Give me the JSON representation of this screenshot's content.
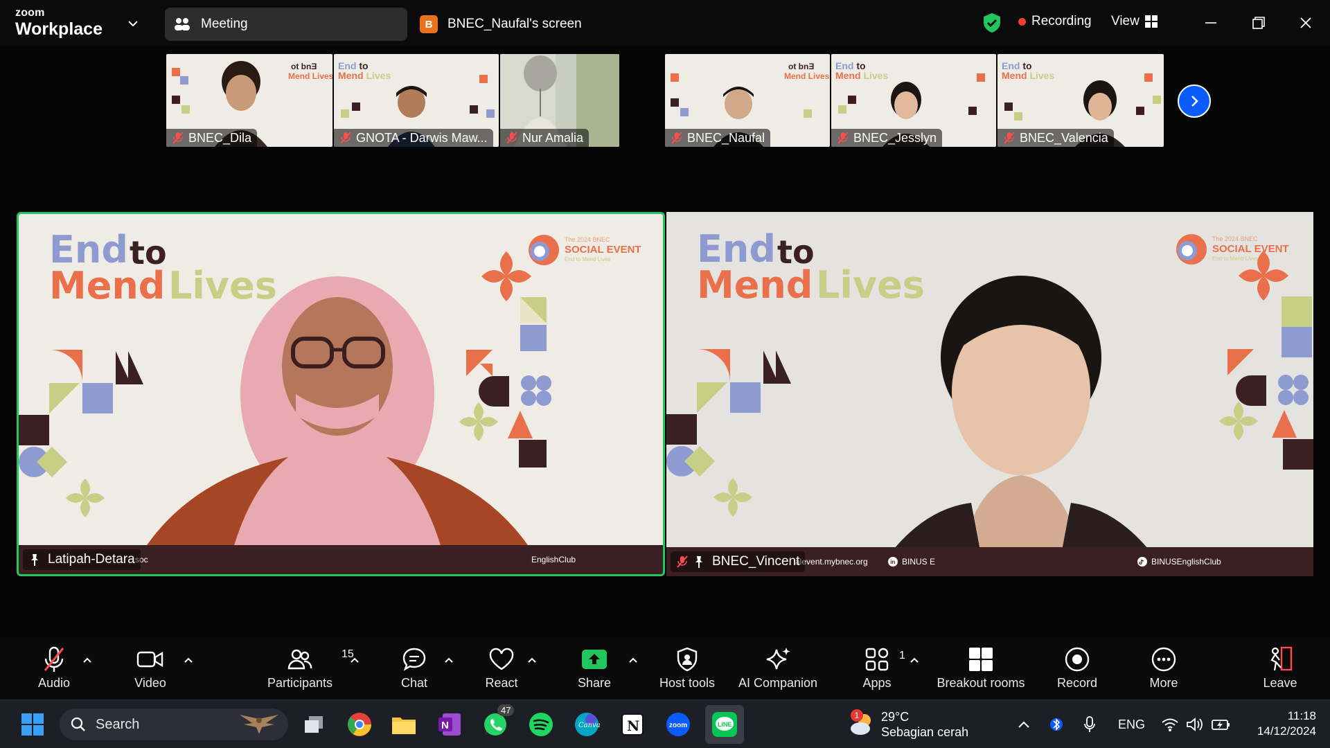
{
  "topbar": {
    "brand_small": "zoom",
    "brand_large": "Workplace",
    "meeting_tab_label": "Meeting",
    "screen_tab_badge": "B",
    "screen_tab_label": "BNEC_Naufal's screen",
    "recording_label": "Recording",
    "view_label": "View"
  },
  "thumbnails": [
    {
      "name": "BNEC_Dila"
    },
    {
      "name": "GNOTA - Darwis Maw..."
    },
    {
      "name": "Nur Amalia"
    },
    {
      "name": "BNEC_Naufal"
    },
    {
      "name": "BNEC_Jesslyn"
    },
    {
      "name": "BNEC_Valencia"
    }
  ],
  "slide": {
    "word_end": "End",
    "word_to": "to",
    "word_mend": "Mend",
    "word_lives": "Lives",
    "logo_line1": "The 2024 BNEC",
    "logo_line2": "SOCIAL EVENT",
    "logo_line3": "End to Mend Lives"
  },
  "main_tiles": [
    {
      "name": "Latipah-Detara",
      "footer_text": "EnglishClub",
      "footer_prefix": "soc"
    },
    {
      "name": "BNEC_Vincent",
      "footer_url": "alevent.mybnec.org",
      "footer_linkedin": "BINUS E",
      "footer_tiktok": "BINUSEnglishClub"
    }
  ],
  "toolbar": {
    "audio": "Audio",
    "video": "Video",
    "participants": "Participants",
    "participants_count": "15",
    "chat": "Chat",
    "react": "React",
    "share": "Share",
    "host_tools": "Host tools",
    "ai_companion": "AI Companion",
    "apps": "Apps",
    "apps_count": "1",
    "breakout_rooms": "Breakout rooms",
    "record": "Record",
    "more": "More",
    "leave": "Leave"
  },
  "taskbar": {
    "search_placeholder": "Search",
    "whatsapp_badge": "47",
    "weather_badge": "1",
    "temperature": "29°C",
    "weather_desc": "Sebagian cerah",
    "language": "ENG",
    "time": "11:18",
    "date": "14/12/2024"
  },
  "colors": {
    "accent_blue": "#0b5cff",
    "active_speaker_border": "#22c55e",
    "recording_red": "#ff3b30",
    "slide_blue": "#8e9bd0",
    "slide_orange": "#e9704b",
    "slide_green": "#c6cf86",
    "slide_dark": "#3b2023"
  }
}
